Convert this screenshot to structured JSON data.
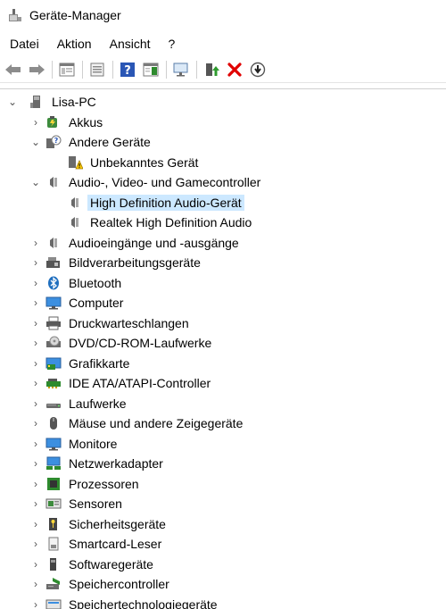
{
  "window": {
    "title": "Geräte-Manager",
    "icon": "device-manager-icon"
  },
  "menubar": {
    "items": [
      {
        "label": "Datei"
      },
      {
        "label": "Aktion"
      },
      {
        "label": "Ansicht"
      },
      {
        "label": "?"
      }
    ]
  },
  "toolbar": {
    "buttons": [
      "back-arrow-icon",
      "forward-arrow-icon",
      "properties-icon",
      "console-tree-icon",
      "help-icon",
      "action-pane-icon",
      "monitor-scan-icon",
      "update-driver-icon",
      "uninstall-icon",
      "disable-icon"
    ]
  },
  "tree": {
    "root": {
      "label": "Lisa-PC",
      "icon": "computer-tower-icon",
      "expanded": true
    },
    "categories": [
      {
        "label": "Akkus",
        "icon": "battery-icon",
        "expanded": false
      },
      {
        "label": "Andere Geräte",
        "icon": "unknown-device-icon",
        "expanded": true,
        "children": [
          {
            "label": "Unbekanntes Gerät",
            "icon": "warning-device-icon"
          }
        ]
      },
      {
        "label": "Audio-, Video- und Gamecontroller",
        "icon": "speaker-icon",
        "expanded": true,
        "children": [
          {
            "label": "High Definition Audio-Gerät",
            "icon": "speaker-icon",
            "selected": true
          },
          {
            "label": "Realtek High Definition Audio",
            "icon": "speaker-icon"
          }
        ]
      },
      {
        "label": "Audioeingänge und -ausgänge",
        "icon": "speaker-icon",
        "expanded": false
      },
      {
        "label": "Bildverarbeitungsgeräte",
        "icon": "camera-icon",
        "expanded": false
      },
      {
        "label": "Bluetooth",
        "icon": "bluetooth-icon",
        "expanded": false
      },
      {
        "label": "Computer",
        "icon": "monitor-icon",
        "expanded": false
      },
      {
        "label": "Druckwarteschlangen",
        "icon": "printer-icon",
        "expanded": false
      },
      {
        "label": "DVD/CD-ROM-Laufwerke",
        "icon": "optical-drive-icon",
        "expanded": false
      },
      {
        "label": "Grafikkarte",
        "icon": "display-adapter-icon",
        "expanded": false
      },
      {
        "label": "IDE ATA/ATAPI-Controller",
        "icon": "ide-controller-icon",
        "expanded": false
      },
      {
        "label": "Laufwerke",
        "icon": "disk-drive-icon",
        "expanded": false
      },
      {
        "label": "Mäuse und andere Zeigegeräte",
        "icon": "mouse-icon",
        "expanded": false
      },
      {
        "label": "Monitore",
        "icon": "monitor-icon",
        "expanded": false
      },
      {
        "label": "Netzwerkadapter",
        "icon": "network-adapter-icon",
        "expanded": false
      },
      {
        "label": "Prozessoren",
        "icon": "processor-icon",
        "expanded": false
      },
      {
        "label": "Sensoren",
        "icon": "sensor-icon",
        "expanded": false
      },
      {
        "label": "Sicherheitsgeräte",
        "icon": "security-key-icon",
        "expanded": false
      },
      {
        "label": "Smartcard-Leser",
        "icon": "smartcard-icon",
        "expanded": false
      },
      {
        "label": "Softwaregeräte",
        "icon": "software-device-icon",
        "expanded": false
      },
      {
        "label": "Speichercontroller",
        "icon": "storage-controller-icon",
        "expanded": false
      },
      {
        "label": "Speichertechnologiegeräte",
        "icon": "storage-tech-icon",
        "expanded": false
      }
    ]
  },
  "colors": {
    "selection": "#cce8ff",
    "accent": "#1f6fbf",
    "uninstall": "#e00000"
  }
}
